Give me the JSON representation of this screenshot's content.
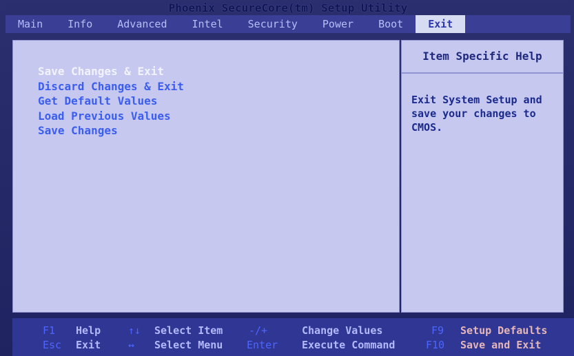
{
  "window": {
    "title": "Phoenix SecureCore(tm) Setup Utility"
  },
  "menu": [
    {
      "label": "Main"
    },
    {
      "label": "Info"
    },
    {
      "label": "Advanced"
    },
    {
      "label": "Intel"
    },
    {
      "label": "Security"
    },
    {
      "label": "Power"
    },
    {
      "label": "Boot"
    },
    {
      "label": "Exit",
      "active": true
    }
  ],
  "main": {
    "items": [
      {
        "label": "Save Changes & Exit",
        "selected": true
      },
      {
        "label": "Discard Changes & Exit"
      },
      {
        "label": "Get Default Values"
      },
      {
        "label": "Load Previous Values"
      },
      {
        "label": "Save Changes"
      }
    ]
  },
  "help": {
    "title": "Item Specific Help",
    "text": "Exit System Setup and\nsave your changes to\nCMOS."
  },
  "footer": {
    "rows": [
      [
        {
          "key": "F1",
          "label": "Help"
        },
        {
          "key": "↑↓",
          "label": "Select Item"
        },
        {
          "key": "-/+",
          "label": "Change Values"
        },
        {
          "key": "F9",
          "label": "Setup Defaults"
        }
      ],
      [
        {
          "key": "Esc",
          "label": "Exit"
        },
        {
          "key": "↔",
          "label": "Select Menu"
        },
        {
          "key": "Enter",
          "label": "Execute Command"
        },
        {
          "key": "F10",
          "label": "Save and Exit"
        }
      ]
    ]
  },
  "colors": {
    "background": "#1f2360",
    "menu_bar": "#3a3f95",
    "panel": "#c6c8ef",
    "item_text": "#3b5ef0",
    "selected_text": "#f2f3ff",
    "help_text": "#1b2a8d"
  }
}
